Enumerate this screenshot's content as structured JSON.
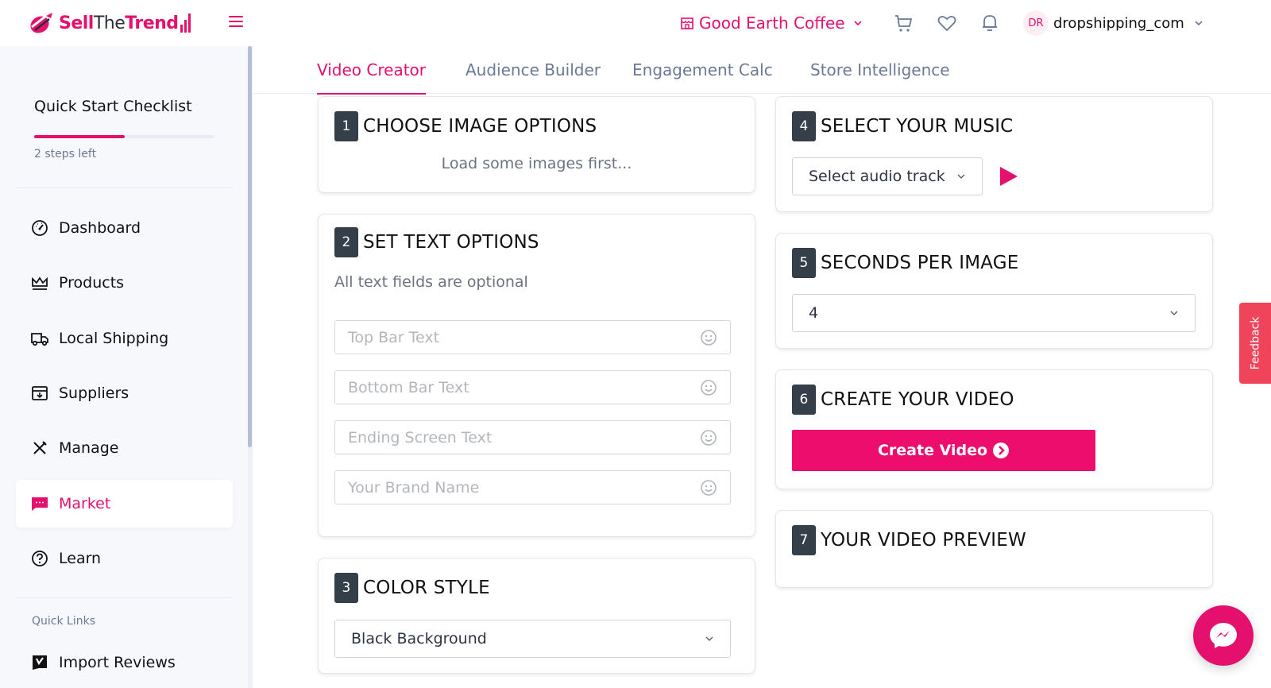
{
  "brand": {
    "name_part1": "Sell",
    "name_part2": "The",
    "name_part3": "Trend",
    "accent_color": "#e5106e"
  },
  "header": {
    "store_selector": {
      "icon": "store-icon",
      "label": "Good Earth Coffee"
    },
    "icons": [
      "cart-icon",
      "heart-icon",
      "bell-icon"
    ],
    "user": {
      "initials": "DR",
      "name": "dropshipping_com"
    }
  },
  "sidebar": {
    "checklist": {
      "title": "Quick Start Checklist",
      "progress_fraction": 0.5,
      "steps_left": "2 steps left"
    },
    "items": [
      {
        "label": "Dashboard",
        "icon": "gauge-icon",
        "active": false
      },
      {
        "label": "Products",
        "icon": "crown-icon",
        "active": false
      },
      {
        "label": "Local Shipping",
        "icon": "truck-icon",
        "active": false
      },
      {
        "label": "Suppliers",
        "icon": "archive-download-icon",
        "active": false
      },
      {
        "label": "Manage",
        "icon": "tools-icon",
        "active": false
      },
      {
        "label": "Market",
        "icon": "chat-icon",
        "active": true
      },
      {
        "label": "Learn",
        "icon": "question-circle-icon",
        "active": false
      }
    ],
    "quick_links_label": "Quick Links",
    "quick_links": [
      {
        "label": "Import Reviews",
        "icon": "reviews-icon"
      }
    ]
  },
  "tabs": [
    {
      "label": "Video Creator",
      "active": true
    },
    {
      "label": "Audience Builder",
      "active": false
    },
    {
      "label": "Engagement Calc",
      "active": false
    },
    {
      "label": "Store Intelligence",
      "active": false
    }
  ],
  "steps": {
    "s1": {
      "num": "1",
      "title": "CHOOSE IMAGE OPTIONS",
      "message": "Load some images first..."
    },
    "s2": {
      "num": "2",
      "title": "SET TEXT OPTIONS",
      "subtitle": "All text fields are optional",
      "fields": [
        {
          "placeholder": "Top Bar Text",
          "value": ""
        },
        {
          "placeholder": "Bottom Bar Text",
          "value": ""
        },
        {
          "placeholder": "Ending Screen Text",
          "value": ""
        },
        {
          "placeholder": "Your Brand Name",
          "value": ""
        }
      ]
    },
    "s3": {
      "num": "3",
      "title": "COLOR STYLE",
      "selected": "Black Background"
    },
    "s4": {
      "num": "4",
      "title": "SELECT YOUR MUSIC",
      "selected": "Select audio track"
    },
    "s5": {
      "num": "5",
      "title": "SECONDS PER IMAGE",
      "selected": "4"
    },
    "s6": {
      "num": "6",
      "title": "CREATE YOUR VIDEO",
      "button_label": "Create Video"
    },
    "s7": {
      "num": "7",
      "title": "YOUR VIDEO PREVIEW"
    }
  },
  "feedback_label": "Feedback"
}
